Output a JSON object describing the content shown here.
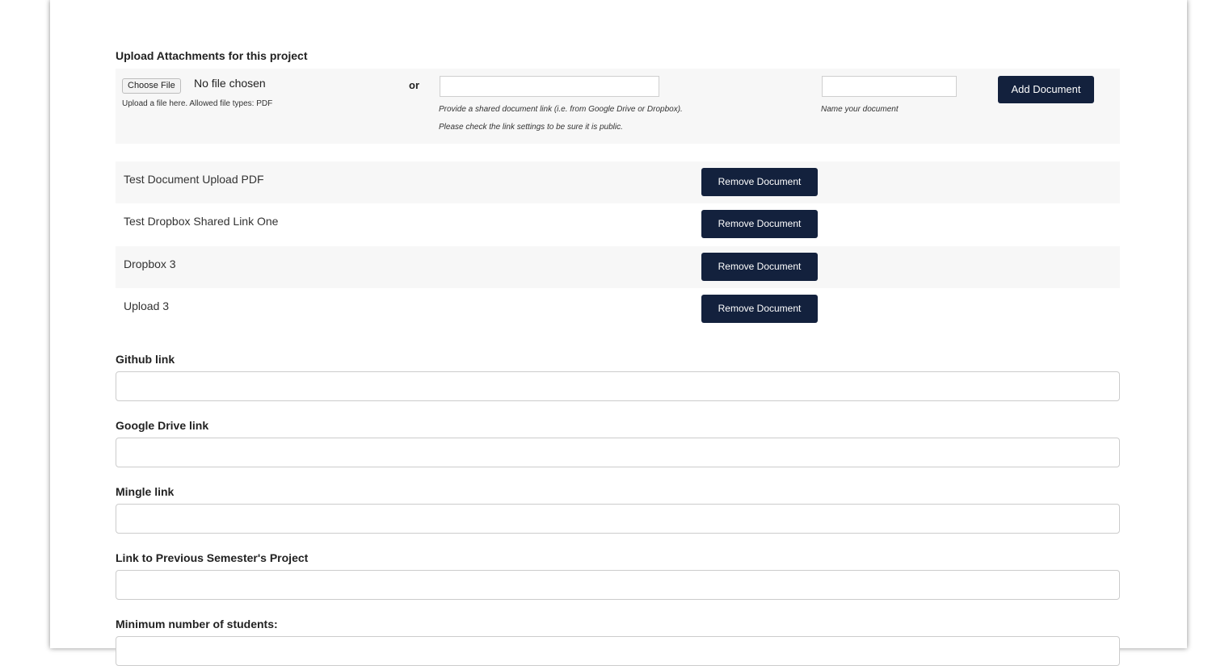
{
  "attachments": {
    "title": "Upload Attachments for this project",
    "choose_file_label": "Choose File",
    "no_file_text": "No file chosen",
    "upload_hint": "Upload a file here. Allowed file types: PDF",
    "or_label": "or",
    "link_input": {
      "value": "",
      "placeholder": ""
    },
    "link_hint_line1": "Provide a shared document link (i.e. from Google Drive or Dropbox).",
    "link_hint_line2": "Please check the link settings to be sure it is public.",
    "name_input": {
      "value": "",
      "placeholder": ""
    },
    "name_hint": "Name your document",
    "add_button": "Add Document"
  },
  "documents": [
    {
      "name": "Test Document Upload PDF",
      "remove_label": "Remove Document"
    },
    {
      "name": "Test Dropbox Shared Link One",
      "remove_label": "Remove Document"
    },
    {
      "name": "Dropbox 3",
      "remove_label": "Remove Document"
    },
    {
      "name": "Upload 3",
      "remove_label": "Remove Document"
    }
  ],
  "fields": {
    "github": {
      "label": "Github link",
      "value": ""
    },
    "google_drive": {
      "label": "Google Drive link",
      "value": ""
    },
    "mingle": {
      "label": "Mingle link",
      "value": ""
    },
    "previous_semester": {
      "label": "Link to Previous Semester's Project",
      "value": ""
    },
    "min_students": {
      "label": "Minimum number of students:",
      "value": ""
    }
  },
  "colors": {
    "primary_button": "#13213d",
    "row_shade": "#f7f7f7"
  }
}
